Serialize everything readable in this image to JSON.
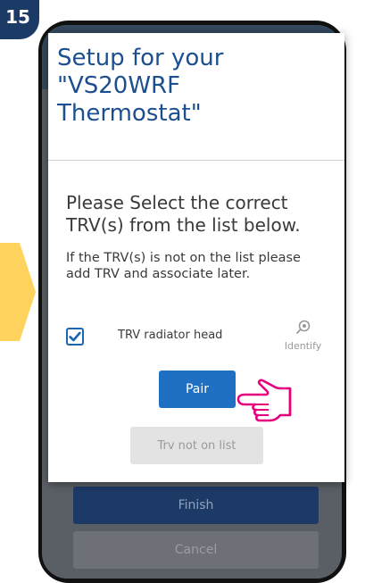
{
  "step_badge": "15",
  "dialog": {
    "title_lines": [
      "Setup for your",
      "\"VS20WRF",
      "Thermostat\""
    ],
    "instruction_lines": [
      "Please Select the correct",
      "TRV(s) from the list below."
    ],
    "note_lines": [
      "If the TRV(s) is not on the list please",
      "add TRV and associate later."
    ],
    "trv_item": {
      "label": "TRV radiator head",
      "checked": true,
      "identify_label": "Identify"
    },
    "pair_button": "Pair",
    "not_on_list_button": "Trv not on list"
  },
  "background": {
    "finish_button": "Finish",
    "cancel_button": "Cancel"
  },
  "colors": {
    "accent": "#1f6fc3",
    "title": "#1c4f8f",
    "arrow": "#fdd35d",
    "hand": "#e6007e"
  },
  "icons": [
    "checkmark-icon",
    "eye-icon",
    "pointing-hand-icon",
    "arrow-icon"
  ]
}
